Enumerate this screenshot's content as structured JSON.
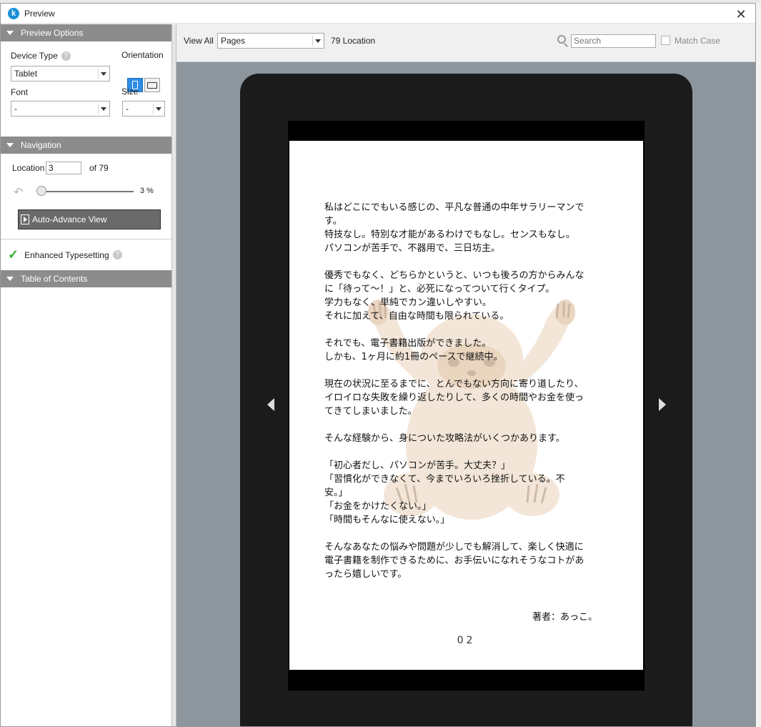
{
  "window": {
    "title": "Preview",
    "icon_letter": "k"
  },
  "left_panel": {
    "preview_options": {
      "header": "Preview Options",
      "device_type_label": "Device Type",
      "device_type_value": "Tablet",
      "orientation_label": "Orientation",
      "font_label": "Font",
      "font_value": "-",
      "size_label": "Size",
      "size_value": "-"
    },
    "navigation": {
      "header": "Navigation",
      "location_label": "Location",
      "location_value": "3",
      "of_label": "of 79",
      "progress_percent": "3 %",
      "progress_fraction": 0.03,
      "auto_advance_label": "Auto-Advance View"
    },
    "enhanced_typesetting_label": "Enhanced Typesetting",
    "toc_header": "Table of Contents"
  },
  "toolbar": {
    "view_all_label": "View All",
    "view_select_value": "Pages",
    "location_count": "79 Location",
    "search_placeholder": "Search",
    "match_case_label": "Match Case"
  },
  "page": {
    "body_text": "私はどこにでもいる感じの、平凡な普通の中年サラリーマンで\nす。\n特技なし。特別な才能があるわけでもなし。センスもなし。\nパソコンが苦手で、不器用で、三日坊主。\n\n優秀でもなく、どちらかというと、いつも後ろの方からみんな\nに「待って～！」と、必死になってついて行くタイプ。\n学力もなく、単純でカン違いしやすい。\nそれに加えて、自由な時間も限られている。\n\nそれでも、電子書籍出版ができました。\nしかも、1ヶ月に約1冊のペースで継続中。\n\n現在の状況に至るまでに、とんでもない方向に寄り道したり、\nイロイロな失敗を繰り返したりして、多くの時間やお金を使っ\nてきてしまいました。\n\nそんな経験から、身についた攻略法がいくつかあります。\n\n「初心者だし、パソコンが苦手。大丈夫？」\n「習慣化ができなくて、今までいろいろ挫折している。不\n安。」\n「お金をかけたくない。」\n「時間もそんなに使えない。」\n\nそんなあなたの悩みや問題が少しでも解消して、楽しく快適に\n電子書籍を制作できるために、お手伝いになれそうなコトがあ\nったら嬉しいです。",
    "author": "著者：あっこ。",
    "page_number": "02"
  }
}
